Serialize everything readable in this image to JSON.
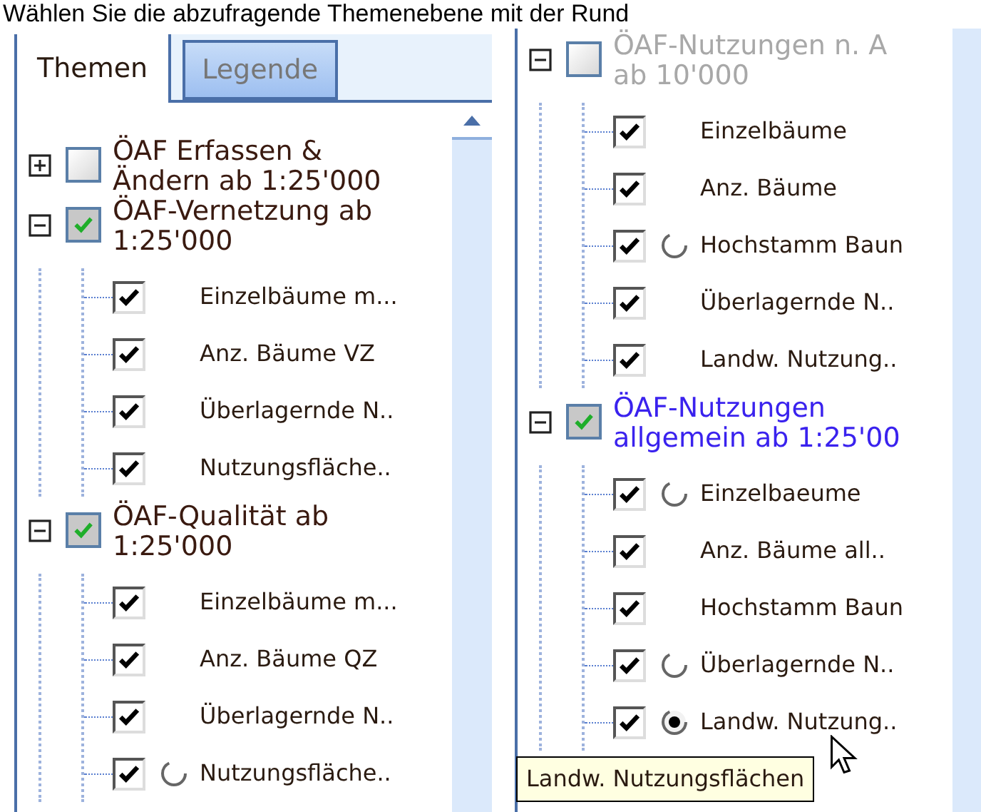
{
  "caption": "Wählen Sie die abzufragende Themenebene mit der Rund",
  "left_panel": {
    "tabs": [
      {
        "label": "Themen",
        "selected": true
      },
      {
        "label": "Legende",
        "selected": false
      }
    ],
    "groups": [
      {
        "label_lines": [
          "ÖAF Erfassen &",
          "Ändern ab 1:25'000"
        ],
        "expanded": false,
        "checked": false,
        "disabled": false,
        "highlighted": false
      },
      {
        "label_lines": [
          "ÖAF-Vernetzung ab",
          "1:25'000"
        ],
        "expanded": true,
        "checked": true,
        "disabled": false,
        "highlighted": false,
        "children": [
          {
            "label": "Einzelbäume m...",
            "checked": true,
            "kind": "plain"
          },
          {
            "label": "Anz. Bäume VZ",
            "checked": true,
            "kind": "plain"
          },
          {
            "label": "Überlagernde N..",
            "checked": true,
            "kind": "plain"
          },
          {
            "label": "Nutzungsfläche..",
            "checked": true,
            "kind": "plain"
          }
        ]
      },
      {
        "label_lines": [
          "ÖAF-Qualität ab",
          "1:25'000"
        ],
        "expanded": true,
        "checked": true,
        "disabled": false,
        "highlighted": false,
        "children": [
          {
            "label": "Einzelbäume m...",
            "checked": true,
            "kind": "plain"
          },
          {
            "label": "Anz. Bäume QZ",
            "checked": true,
            "kind": "plain"
          },
          {
            "label": "Überlagernde N..",
            "checked": true,
            "kind": "plain"
          },
          {
            "label": "Nutzungsfläche..",
            "checked": true,
            "kind": "radio",
            "selected": false
          }
        ]
      }
    ]
  },
  "right_panel": {
    "groups": [
      {
        "label_lines": [
          "ÖAF-Nutzungen n. A",
          "ab 10'000"
        ],
        "expanded": true,
        "checked": false,
        "disabled": true,
        "highlighted": false,
        "children": [
          {
            "label": "Einzelbäume",
            "checked": true,
            "kind": "plain"
          },
          {
            "label": "Anz. Bäume",
            "checked": true,
            "kind": "plain"
          },
          {
            "label": "Hochstamm Baun",
            "checked": true,
            "kind": "radio",
            "selected": false
          },
          {
            "label": "Überlagernde N..",
            "checked": true,
            "kind": "plain"
          },
          {
            "label": "Landw. Nutzung..",
            "checked": true,
            "kind": "plain"
          }
        ]
      },
      {
        "label_lines": [
          "ÖAF-Nutzungen",
          "allgemein ab 1:25'00"
        ],
        "expanded": true,
        "checked": true,
        "disabled": false,
        "highlighted": true,
        "children": [
          {
            "label": "Einzelbaeume",
            "checked": true,
            "kind": "radio",
            "selected": false
          },
          {
            "label": "Anz. Bäume all..",
            "checked": true,
            "kind": "plain"
          },
          {
            "label": "Hochstamm Baun",
            "checked": true,
            "kind": "plain"
          },
          {
            "label": "Überlagernde N..",
            "checked": true,
            "kind": "radio",
            "selected": false
          },
          {
            "label": "Landw. Nutzung..",
            "checked": true,
            "kind": "radio",
            "selected": true
          }
        ]
      }
    ],
    "tooltip": "Landw. Nutzungsflächen"
  }
}
